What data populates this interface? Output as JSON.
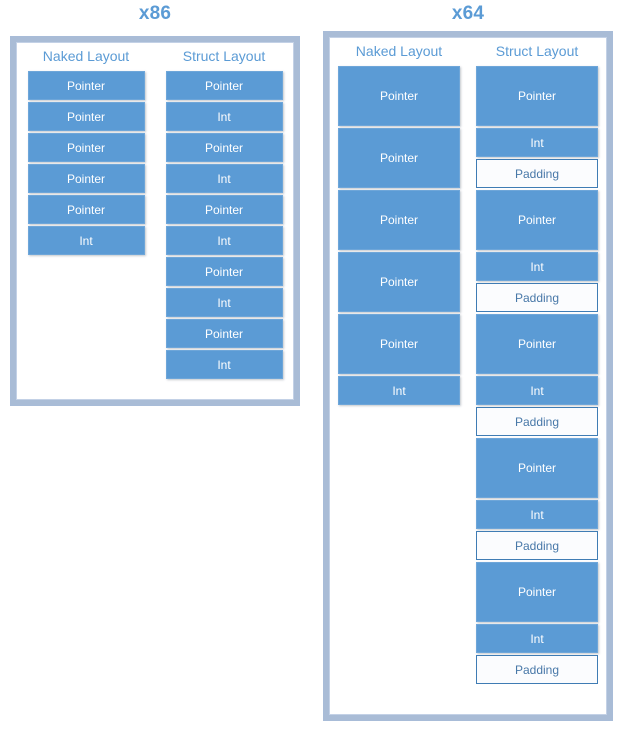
{
  "colors": {
    "accent_blue": "#5B9BD5",
    "frame_blue": "#A9BCD6",
    "padding_border": "#3F7CB4",
    "block_text": "#FFFFFF",
    "padding_text": "#4878A8"
  },
  "labels": {
    "pointer": "Pointer",
    "int": "Int",
    "padding": "Padding"
  },
  "panels": [
    {
      "id": "x86",
      "title": "x86",
      "columns": [
        {
          "header": "Naked Layout",
          "blocks": [
            {
              "label": "Pointer",
              "kind": "filled",
              "size": 1
            },
            {
              "label": "Pointer",
              "kind": "filled",
              "size": 1
            },
            {
              "label": "Pointer",
              "kind": "filled",
              "size": 1
            },
            {
              "label": "Pointer",
              "kind": "filled",
              "size": 1
            },
            {
              "label": "Pointer",
              "kind": "filled",
              "size": 1
            },
            {
              "label": "Int",
              "kind": "filled",
              "size": 1
            }
          ]
        },
        {
          "header": "Struct Layout",
          "blocks": [
            {
              "label": "Pointer",
              "kind": "filled",
              "size": 1
            },
            {
              "label": "Int",
              "kind": "filled",
              "size": 1
            },
            {
              "label": "Pointer",
              "kind": "filled",
              "size": 1
            },
            {
              "label": "Int",
              "kind": "filled",
              "size": 1
            },
            {
              "label": "Pointer",
              "kind": "filled",
              "size": 1
            },
            {
              "label": "Int",
              "kind": "filled",
              "size": 1
            },
            {
              "label": "Pointer",
              "kind": "filled",
              "size": 1
            },
            {
              "label": "Int",
              "kind": "filled",
              "size": 1
            },
            {
              "label": "Pointer",
              "kind": "filled",
              "size": 1
            },
            {
              "label": "Int",
              "kind": "filled",
              "size": 1
            }
          ]
        }
      ]
    },
    {
      "id": "x64",
      "title": "x64",
      "columns": [
        {
          "header": "Naked Layout",
          "blocks": [
            {
              "label": "Pointer",
              "kind": "filled",
              "size": 2
            },
            {
              "label": "Pointer",
              "kind": "filled",
              "size": 2
            },
            {
              "label": "Pointer",
              "kind": "filled",
              "size": 2
            },
            {
              "label": "Pointer",
              "kind": "filled",
              "size": 2
            },
            {
              "label": "Pointer",
              "kind": "filled",
              "size": 2
            },
            {
              "label": "Int",
              "kind": "filled",
              "size": 1
            }
          ]
        },
        {
          "header": "Struct Layout",
          "blocks": [
            {
              "label": "Pointer",
              "kind": "filled",
              "size": 2
            },
            {
              "label": "Int",
              "kind": "filled",
              "size": 1
            },
            {
              "label": "Padding",
              "kind": "padding",
              "size": 1
            },
            {
              "label": "Pointer",
              "kind": "filled",
              "size": 2
            },
            {
              "label": "Int",
              "kind": "filled",
              "size": 1
            },
            {
              "label": "Padding",
              "kind": "padding",
              "size": 1
            },
            {
              "label": "Pointer",
              "kind": "filled",
              "size": 2
            },
            {
              "label": "Int",
              "kind": "filled",
              "size": 1
            },
            {
              "label": "Padding",
              "kind": "padding",
              "size": 1
            },
            {
              "label": "Pointer",
              "kind": "filled",
              "size": 2
            },
            {
              "label": "Int",
              "kind": "filled",
              "size": 1
            },
            {
              "label": "Padding",
              "kind": "padding",
              "size": 1
            },
            {
              "label": "Pointer",
              "kind": "filled",
              "size": 2
            },
            {
              "label": "Int",
              "kind": "filled",
              "size": 1
            },
            {
              "label": "Padding",
              "kind": "padding",
              "size": 1
            }
          ]
        }
      ]
    }
  ]
}
